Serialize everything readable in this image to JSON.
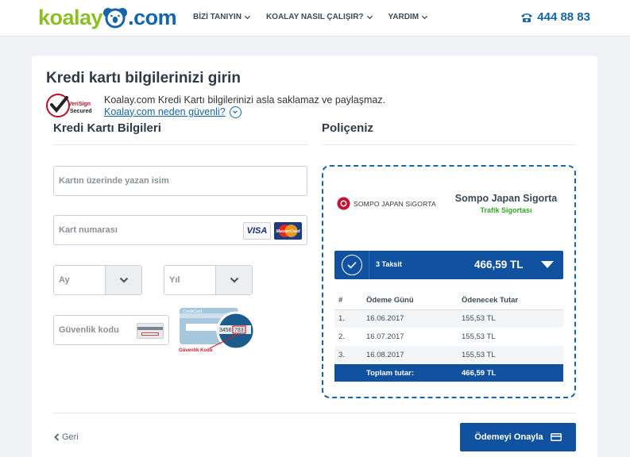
{
  "header": {
    "logo_left": "koalay",
    "logo_right": "com",
    "nav": [
      {
        "label": "BİZİ TANIYIN"
      },
      {
        "label": "KOALAY NASIL ÇALIŞIR?"
      },
      {
        "label": "YARDIM"
      }
    ],
    "phone": "444 88 83"
  },
  "page": {
    "title": "Kredi kartı bilgilerinizi girin",
    "verisign_line1": "VeriSign",
    "verisign_line2": "Secured",
    "notice": "Koalay.com Kredi Kartı bilgilerinizi asla saklamaz ve paylaşmaz.",
    "notice_link": "Koalay.com neden güvenli?"
  },
  "card_form": {
    "heading": "Kredi Kartı Bilgileri",
    "name_placeholder": "Kartın üzerinde yazan isim",
    "number_placeholder": "Kart numarası",
    "visa_label": "VISA",
    "mastercard_label": "MasterCard",
    "month_label": "Ay",
    "year_label": "Yıl",
    "cvv_placeholder": "Güvenlik kodu",
    "cvv_card_brand": "CreditCard",
    "cvv_digits_a": "3456",
    "cvv_digits_b": "783",
    "cvv_caption": "Güvenlik Kodu"
  },
  "policy": {
    "heading": "Poliçeniz",
    "insurer_logo_text": "SOMPO JAPAN SiGORTA",
    "insurer_name": "Sompo Japan Sigorta",
    "product": "Trafik Sigortası",
    "installment_label": "3 Taksit",
    "installment_amount": "466,59 TL",
    "table": {
      "headers": [
        "#",
        "Ödeme Günü",
        "Ödenecek Tutar"
      ],
      "rows": [
        [
          "1.",
          "16.06.2017",
          "155,53 TL"
        ],
        [
          "2.",
          "16.07.2017",
          "155,53 TL"
        ],
        [
          "3.",
          "16.08.2017",
          "155,53 TL"
        ]
      ],
      "total_label": "Toplam tutar:",
      "total_value": "466,59 TL"
    }
  },
  "footer": {
    "back_label": "Geri",
    "confirm_label": "Ödemeyi Onayla"
  },
  "colors": {
    "brand_blue": "#1152a0",
    "brand_green": "#8cbf26",
    "product_green": "#34a824"
  }
}
